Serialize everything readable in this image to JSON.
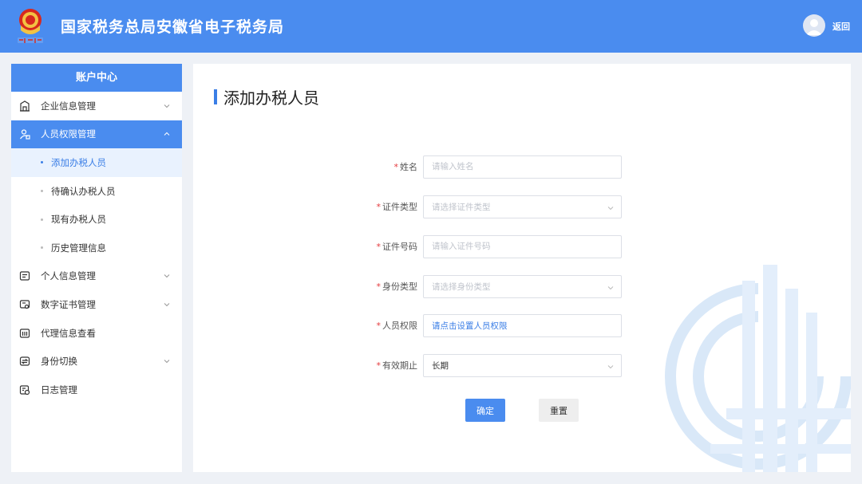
{
  "header": {
    "title": "国家税务总局安徽省电子税务局",
    "back_label": "返回",
    "emblem_text": "中国税务"
  },
  "sidebar": {
    "header": "账户中心",
    "items": [
      {
        "label": "企业信息管理",
        "icon": "building-icon",
        "expandable": true
      },
      {
        "label": "人员权限管理",
        "icon": "user-lock-icon",
        "expandable": true,
        "active": true,
        "expanded": true
      },
      {
        "label": "个人信息管理",
        "icon": "profile-card-icon",
        "expandable": true
      },
      {
        "label": "数字证书管理",
        "icon": "certificate-icon",
        "expandable": true
      },
      {
        "label": "代理信息查看",
        "icon": "agent-icon",
        "expandable": false
      },
      {
        "label": "身份切换",
        "icon": "switch-icon",
        "expandable": true
      },
      {
        "label": "日志管理",
        "icon": "log-icon",
        "expandable": false
      }
    ],
    "sub_items": [
      {
        "label": "添加办税人员",
        "current": true
      },
      {
        "label": "待确认办税人员"
      },
      {
        "label": "现有办税人员"
      },
      {
        "label": "历史管理信息"
      }
    ]
  },
  "main": {
    "title": "添加办税人员",
    "form": {
      "name": {
        "label": "姓名",
        "placeholder": "请输入姓名"
      },
      "id_type": {
        "label": "证件类型",
        "placeholder": "请选择证件类型"
      },
      "id_number": {
        "label": "证件号码",
        "placeholder": "请输入证件号码"
      },
      "identity_type": {
        "label": "身份类型",
        "placeholder": "请选择身份类型"
      },
      "permission": {
        "label": "人员权限",
        "link_text": "请点击设置人员权限"
      },
      "validity": {
        "label": "有效期止",
        "value": "长期"
      }
    },
    "buttons": {
      "confirm": "确定",
      "reset": "重置"
    }
  },
  "colors": {
    "primary": "#4a8cef",
    "required": "#e4393c",
    "link": "#3a7ee6"
  }
}
